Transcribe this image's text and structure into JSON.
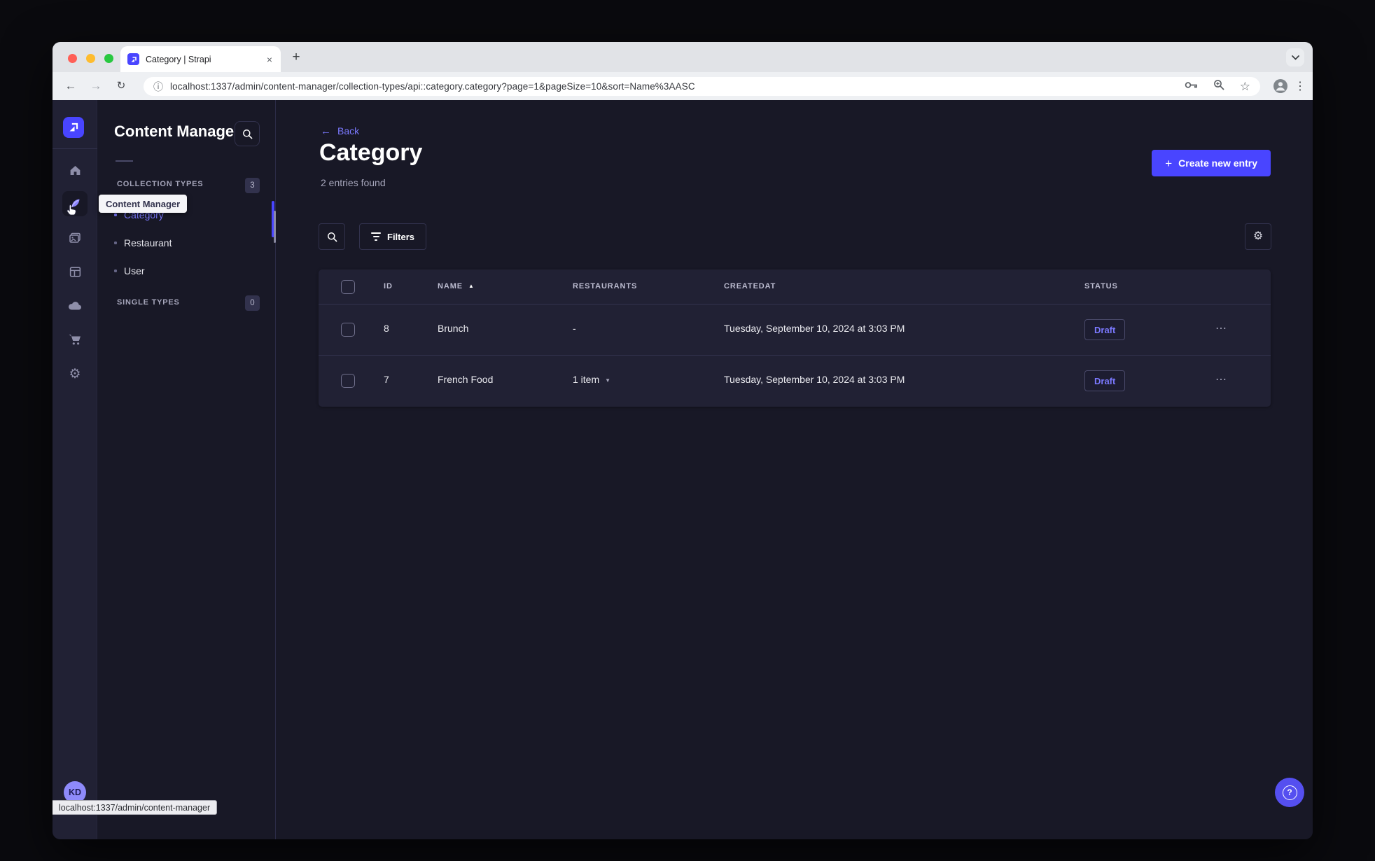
{
  "browser": {
    "tab_title": "Category | Strapi",
    "url": "localhost:1337/admin/content-manager/collection-types/api::category.category?page=1&pageSize=10&sort=Name%3AASC",
    "status_bar_url": "localhost:1337/admin/content-manager",
    "toolbar_icon_names": [
      "back-arrow",
      "forward-arrow",
      "reload",
      "info",
      "password-key",
      "zoom-magnifier",
      "bookmark-star",
      "profile",
      "kebab-menu"
    ]
  },
  "colors": {
    "accent": "#4945ff",
    "accent_light": "#7b79ff",
    "page_bg": "#181826",
    "card_bg": "#212134",
    "border": "#32324d"
  },
  "sidebar": {
    "icon_names": [
      "strapi-logo",
      "home",
      "content-manager",
      "media-library",
      "content-type-builder",
      "deploy-cloud",
      "marketplace",
      "settings"
    ],
    "avatar_initials": "KD"
  },
  "subnav": {
    "title": "Content Manager",
    "tooltip": "Content Manager",
    "sections": [
      {
        "label": "COLLECTION TYPES",
        "badge": "3",
        "items": [
          {
            "label": "Category",
            "active": true
          },
          {
            "label": "Restaurant",
            "active": false
          },
          {
            "label": "User",
            "active": false
          }
        ]
      },
      {
        "label": "SINGLE TYPES",
        "badge": "0",
        "items": []
      }
    ]
  },
  "main": {
    "back_label": "Back",
    "title": "Category",
    "subtitle": "2 entries found",
    "create_button": "Create new entry",
    "filters_button": "Filters",
    "help_label": "?",
    "table": {
      "headers": [
        "ID",
        "NAME",
        "RESTAURANTS",
        "CREATEDAT",
        "STATUS"
      ],
      "rows": [
        {
          "id": "8",
          "name": "Brunch",
          "restaurants": "-",
          "created_at": "Tuesday, September 10, 2024 at 3:03 PM",
          "status": "Draft"
        },
        {
          "id": "7",
          "name": "French Food",
          "restaurants": "1 item",
          "created_at": "Tuesday, September 10, 2024 at 3:03 PM",
          "status": "Draft"
        }
      ]
    }
  }
}
